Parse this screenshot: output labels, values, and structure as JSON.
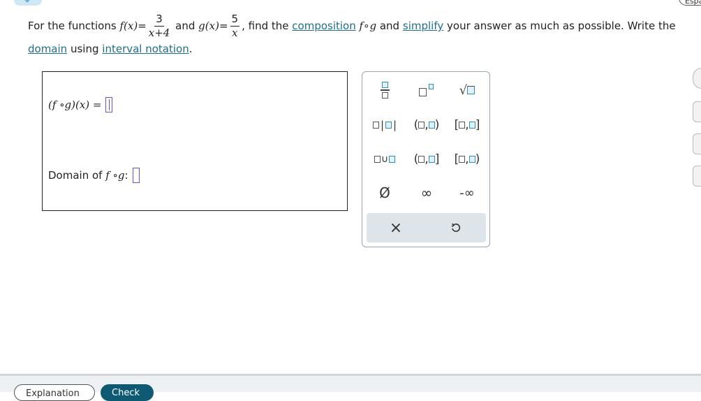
{
  "header": {
    "nav_tab_icon": "chevron-down-icon",
    "top_right_label": "Espa"
  },
  "question": {
    "intro": "For the functions",
    "f_name": "f",
    "x_paren": "(x)",
    "eq": "=",
    "f_num": "3",
    "f_den": "x+4",
    "and": "and",
    "g_name": "g",
    "g_num": "5",
    "g_den": "x",
    "comma": ",",
    "find": "find the",
    "composition_link": "composition",
    "comp_f": "f",
    "comp_circ": "∘",
    "comp_g": "g",
    "and2": "and",
    "simplify_link": "simplify",
    "rest": "your answer as much as possible. Write the",
    "domain_link": "domain",
    "using": "using",
    "interval_link": "interval notation",
    "period": "."
  },
  "answer": {
    "comp_label": "(f ∘g)(x) =",
    "domain_label": "Domain of",
    "domain_fg": "f ∘g",
    "domain_colon": ":"
  },
  "palette": {
    "union": "∪",
    "empty_set": "Ø",
    "infinity": "∞",
    "neg_infinity": "-∞",
    "clear": "×",
    "undo_icon": "undo-icon"
  },
  "footer": {
    "explanation_label": "Explanation",
    "check_label": "Check"
  },
  "colors": {
    "link": "#1d6f8c",
    "placeholder": "#6b4fd8",
    "palette_accent": "#2c8fb8",
    "check_button": "#0d5a72"
  }
}
